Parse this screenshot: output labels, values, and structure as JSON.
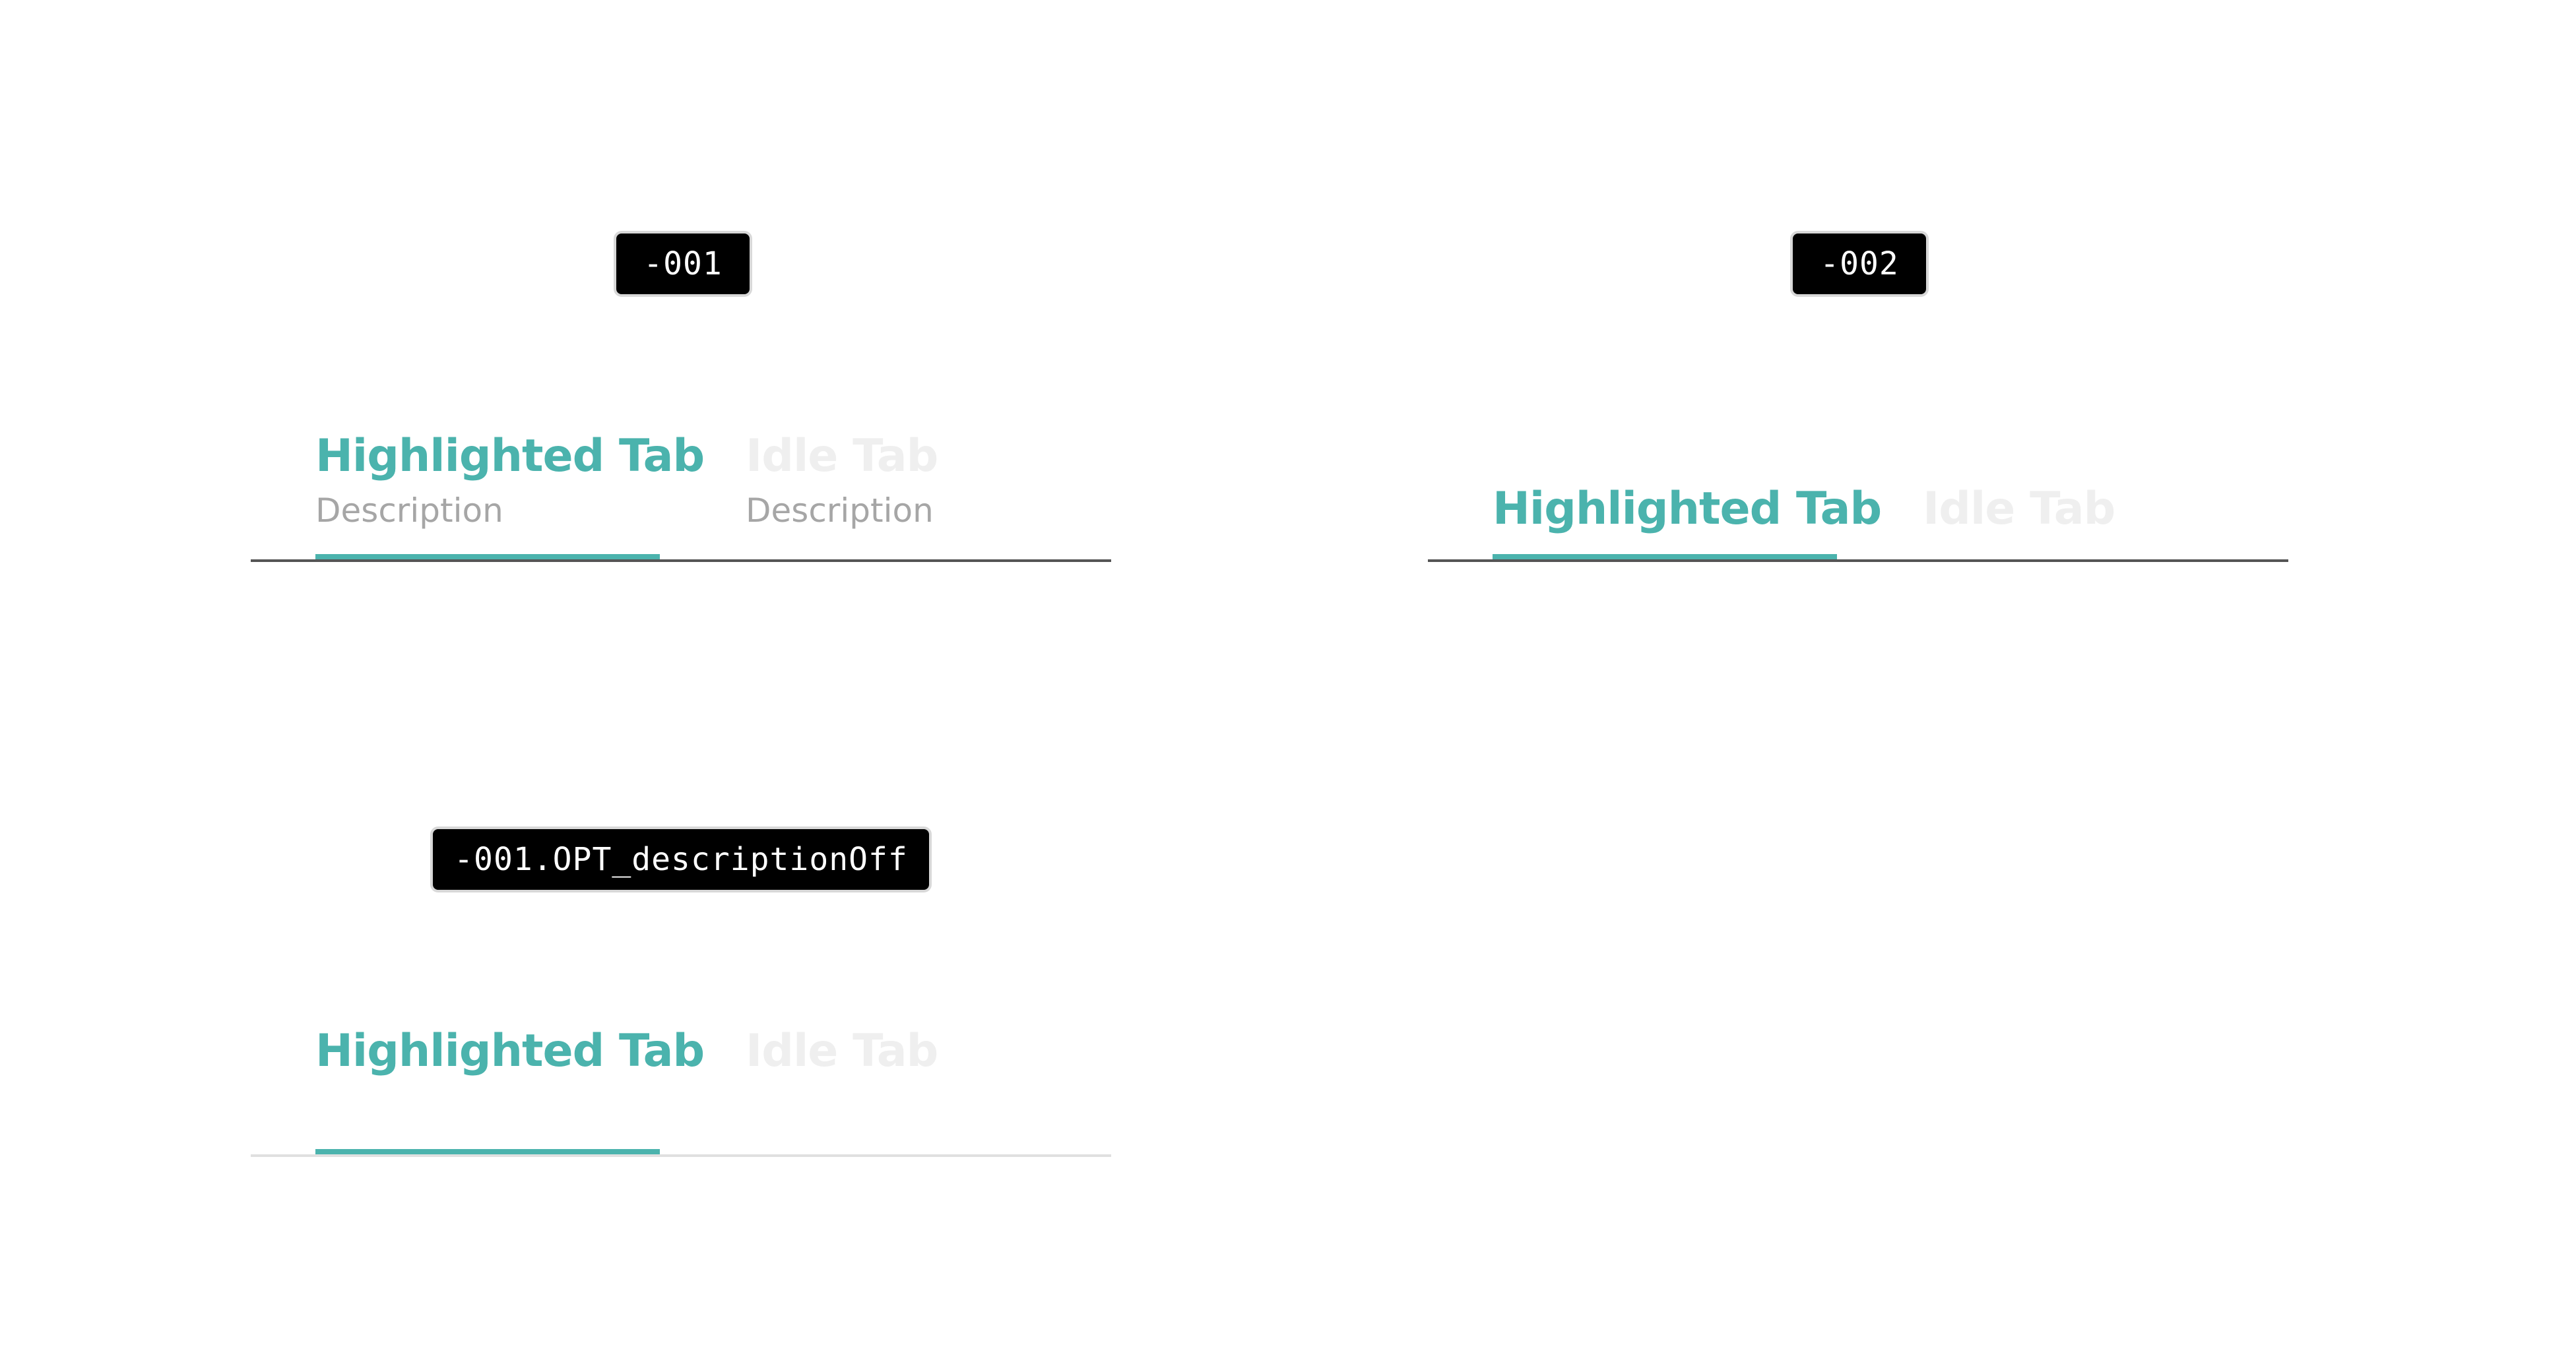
{
  "variants": [
    {
      "tag": "-001",
      "highlighted_tab": {
        "title": "Highlighted Tab",
        "description": "Description"
      },
      "idle_tab": {
        "title": "Idle Tab",
        "description": "Description"
      }
    },
    {
      "tag": "-002",
      "highlighted_tab": {
        "title": "Highlighted Tab"
      },
      "idle_tab": {
        "title": "Idle Tab"
      }
    },
    {
      "tag": "-001.OPT_descriptionOff",
      "highlighted_tab": {
        "title": "Highlighted Tab"
      },
      "idle_tab": {
        "title": "Idle Tab"
      }
    }
  ],
  "colors": {
    "accent": "#4bb3ad",
    "idle_text": "#efefef",
    "description_text": "#a6a6a6",
    "baseline_dark": "#555555",
    "baseline_light": "#e0e0e0",
    "tag_background": "#000000"
  }
}
